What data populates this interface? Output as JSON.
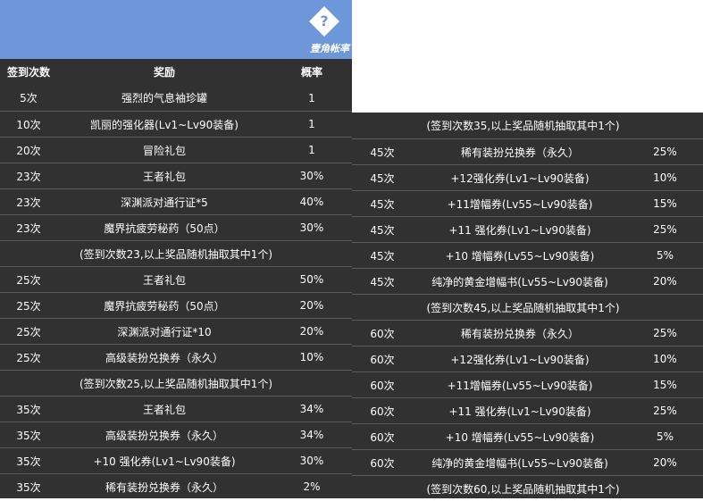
{
  "logo": {
    "text": "壹角帐率",
    "glyph": "?"
  },
  "left_table": {
    "headers": [
      "签到次数",
      "奖励",
      "概率"
    ],
    "rows": [
      {
        "type": "row",
        "c": [
          "5次",
          "强烈的气息袖珍罐",
          "1"
        ]
      },
      {
        "type": "row",
        "c": [
          "10次",
          "凯丽的强化器(Lv1~Lv90装备)",
          "1"
        ]
      },
      {
        "type": "row",
        "c": [
          "20次",
          "冒险礼包",
          "1"
        ]
      },
      {
        "type": "row",
        "c": [
          "23次",
          "王者礼包",
          "30%"
        ]
      },
      {
        "type": "row",
        "c": [
          "23次",
          "深渊派对通行证*5",
          "40%"
        ]
      },
      {
        "type": "row",
        "c": [
          "23次",
          "魔界抗疲劳秘药（50点）",
          "30%"
        ]
      },
      {
        "type": "note",
        "text": "(签到次数23,以上奖品随机抽取其中1个)"
      },
      {
        "type": "row",
        "c": [
          "25次",
          "王者礼包",
          "50%"
        ]
      },
      {
        "type": "row",
        "c": [
          "25次",
          "魔界抗疲劳秘药（50点）",
          "20%"
        ]
      },
      {
        "type": "row",
        "c": [
          "25次",
          "深渊派对通行证*10",
          "20%"
        ]
      },
      {
        "type": "row",
        "c": [
          "25次",
          "高级装扮兑换券（永久）",
          "10%"
        ]
      },
      {
        "type": "note",
        "text": "(签到次数25,以上奖品随机抽取其中1个)"
      },
      {
        "type": "row",
        "c": [
          "35次",
          "王者礼包",
          "34%"
        ]
      },
      {
        "type": "row",
        "c": [
          "35次",
          "高级装扮兑换券（永久）",
          "34%"
        ]
      },
      {
        "type": "row",
        "c": [
          "35次",
          "+10 强化券(Lv1~Lv90装备)",
          "30%"
        ]
      },
      {
        "type": "row",
        "c": [
          "35次",
          "稀有装扮兑换券（永久）",
          "2%"
        ]
      }
    ]
  },
  "right_table": {
    "rows": [
      {
        "type": "note",
        "text": "(签到次数35,以上奖品随机抽取其中1个)"
      },
      {
        "type": "row",
        "c": [
          "45次",
          "稀有装扮兑换券（永久）",
          "25%"
        ]
      },
      {
        "type": "row",
        "c": [
          "45次",
          "+12强化券(Lv1~Lv90装备)",
          "10%"
        ]
      },
      {
        "type": "row",
        "c": [
          "45次",
          "+11增幅券(Lv55~Lv90装备)",
          "15%"
        ]
      },
      {
        "type": "row",
        "c": [
          "45次",
          "+11 强化券(Lv1~Lv90装备)",
          "25%"
        ]
      },
      {
        "type": "row",
        "c": [
          "45次",
          "+10 增幅券(Lv55~Lv90装备)",
          "5%"
        ]
      },
      {
        "type": "row",
        "c": [
          "45次",
          "纯净的黄金增幅书(Lv55~Lv90装备)",
          "20%"
        ]
      },
      {
        "type": "note",
        "text": "(签到次数45,以上奖品随机抽取其中1个)"
      },
      {
        "type": "row",
        "c": [
          "60次",
          "稀有装扮兑换券（永久）",
          "25%"
        ]
      },
      {
        "type": "row",
        "c": [
          "60次",
          "+12强化券(Lv1~Lv90装备)",
          "10%"
        ]
      },
      {
        "type": "row",
        "c": [
          "60次",
          "+11增幅券(Lv55~Lv90装备)",
          "15%"
        ]
      },
      {
        "type": "row",
        "c": [
          "60次",
          "+11 强化券(Lv1~Lv90装备)",
          "25%"
        ]
      },
      {
        "type": "row",
        "c": [
          "60次",
          "+10 增幅券(Lv55~Lv90装备)",
          "5%"
        ]
      },
      {
        "type": "row",
        "c": [
          "60次",
          "纯净的黄金增幅书(Lv55~Lv90装备)",
          "20%"
        ]
      },
      {
        "type": "note",
        "text": "(签到次数60,以上奖品随机抽取其中1个)"
      }
    ]
  }
}
